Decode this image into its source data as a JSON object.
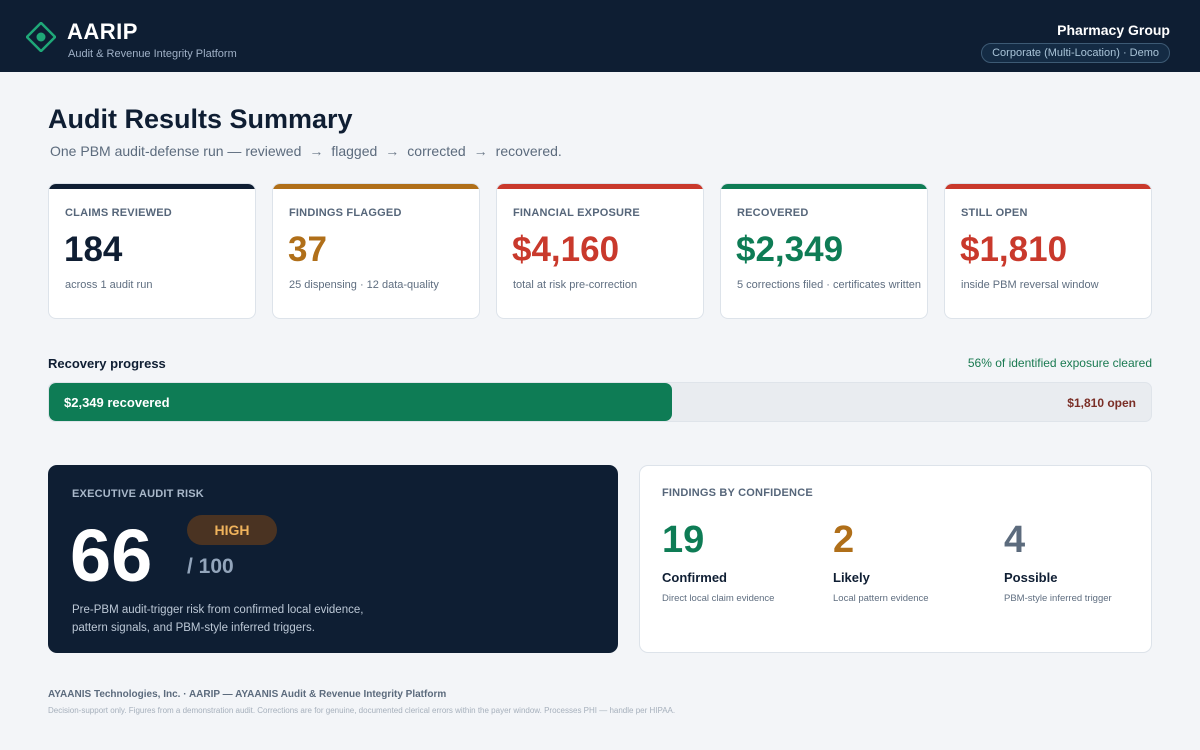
{
  "header": {
    "brand_name": "AARIP",
    "brand_subtitle": "Audit & Revenue Integrity Platform",
    "brand_icon": "diamond-logo-icon",
    "org_name": "Pharmacy Group",
    "org_context": "Corporate (Multi-Location) · Demo"
  },
  "page": {
    "title": "Audit Results Summary",
    "subtitle_parts": [
      "One PBM audit-defense run — reviewed",
      "flagged",
      "corrected",
      "recovered."
    ],
    "arrow": "→"
  },
  "kpis": [
    {
      "label": "CLAIMS REVIEWED",
      "value": "184",
      "note": "across 1 audit run",
      "color": "#0f1e33"
    },
    {
      "label": "FINDINGS FLAGGED",
      "value": "37",
      "note": "25 dispensing · 12 data-quality",
      "color": "#b06f19"
    },
    {
      "label": "FINANCIAL EXPOSURE",
      "value": "$4,160",
      "note": "total at risk pre-correction",
      "color": "#c9392c"
    },
    {
      "label": "RECOVERED",
      "value": "$2,349",
      "note": "5 corrections filed · certificates written",
      "color": "#0e7c55"
    },
    {
      "label": "STILL OPEN",
      "value": "$1,810",
      "note": "inside PBM reversal window",
      "color": "#c9392c"
    }
  ],
  "progress": {
    "title": "Recovery progress",
    "summary": "56% of identified exposure cleared",
    "fill_fraction": 0.565,
    "fill_label": "$2,349 recovered",
    "open_label": "$1,810 open"
  },
  "risk": {
    "label": "EXECUTIVE AUDIT RISK",
    "score": "66",
    "level": "HIGH",
    "max": "/ 100",
    "description": "Pre-PBM audit-trigger risk from confirmed local evidence, pattern signals, and PBM-style inferred triggers."
  },
  "confidence": {
    "label": "FINDINGS BY CONFIDENCE",
    "items": [
      {
        "count": "19",
        "name": "Confirmed",
        "desc": "Direct local claim evidence",
        "color": "#0e7c55"
      },
      {
        "count": "2",
        "name": "Likely",
        "desc": "Local pattern evidence",
        "color": "#b06f19"
      },
      {
        "count": "4",
        "name": "Possible",
        "desc": "PBM-style inferred trigger",
        "color": "#5c6b7d"
      }
    ]
  },
  "footer": {
    "line1": "AYAANIS Technologies, Inc. · AARIP — AYAANIS Audit & Revenue Integrity Platform",
    "line2": "Decision-support only. Figures from a demonstration audit. Corrections are for genuine, documented clerical errors within the payer window. Processes PHI — handle per HIPAA."
  },
  "colors": {
    "navy": "#0e1e33",
    "green": "#0e7c55",
    "amber": "#b06f19",
    "red": "#c9392c"
  }
}
